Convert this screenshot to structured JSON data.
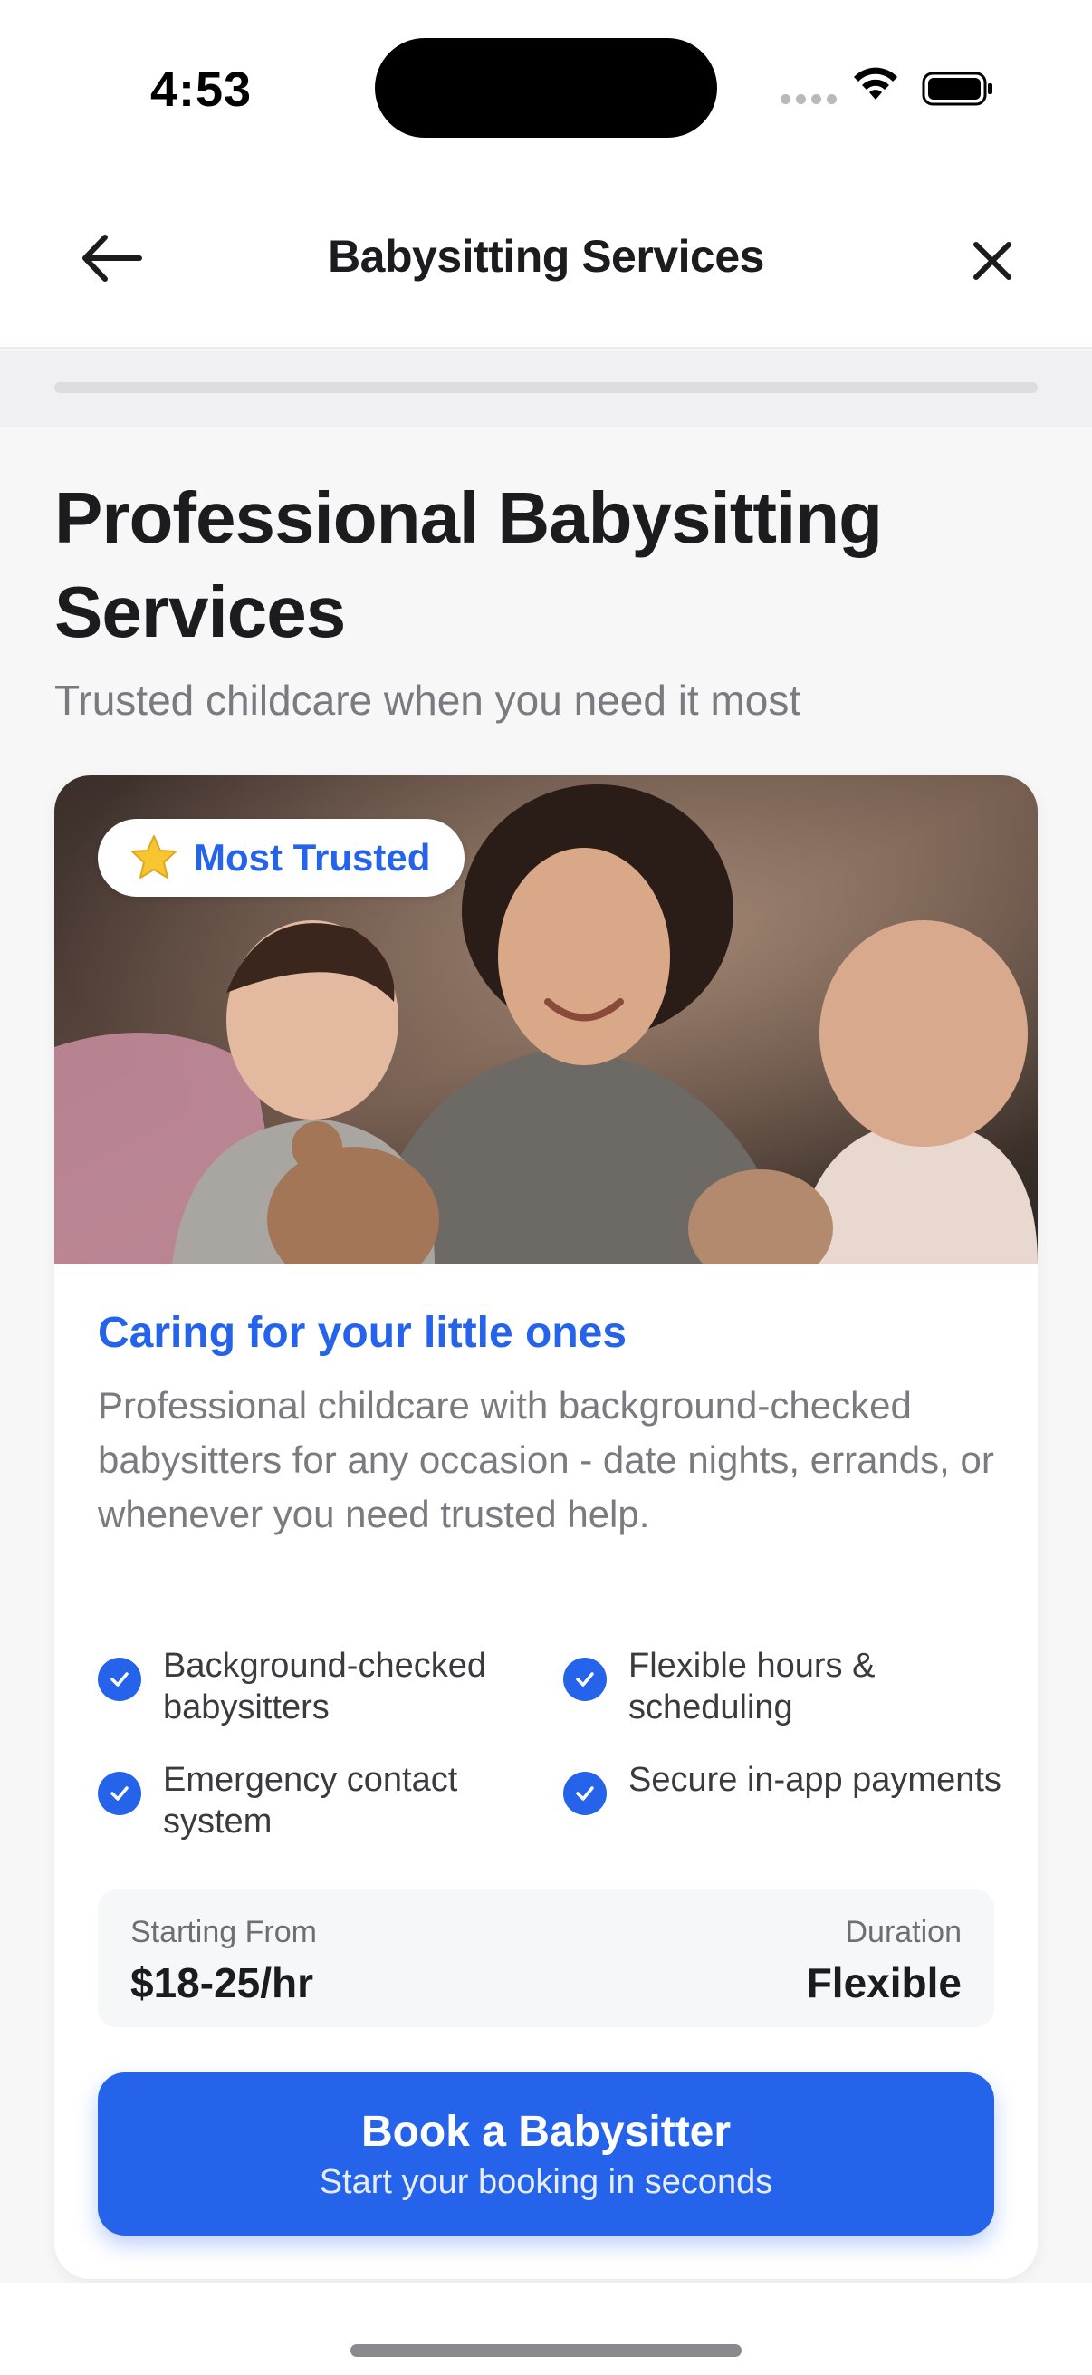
{
  "status_bar": {
    "time": "4:53"
  },
  "nav": {
    "title": "Babysitting Services"
  },
  "progress": {
    "fraction": 1.0
  },
  "header": {
    "title": "Professional Babysitting Services",
    "subtitle": "Trusted childcare when you need it most"
  },
  "card": {
    "badge": {
      "icon": "star-icon",
      "label": "Most Trusted"
    },
    "title": "Caring for your little ones",
    "description": "Professional childcare with background-checked babysitters for any occasion - date nights, errands, or whenever you need trusted help.",
    "features": [
      {
        "label": "Background-checked babysitters"
      },
      {
        "label": "Flexible hours & scheduling"
      },
      {
        "label": "Emergency contact system"
      },
      {
        "label": "Secure in-app payments"
      }
    ],
    "pricing": {
      "starting_caption": "Starting From",
      "starting_value": "$18-25/hr",
      "duration_caption": "Duration",
      "duration_value": "Flexible"
    },
    "cta": {
      "label": "Book a Babysitter",
      "sublabel": "Start your booking in seconds"
    }
  },
  "colors": {
    "accent": "#2563eb",
    "text_primary": "#1c1c1e",
    "text_secondary": "#7a7a80",
    "background": "#f7f7f8"
  }
}
